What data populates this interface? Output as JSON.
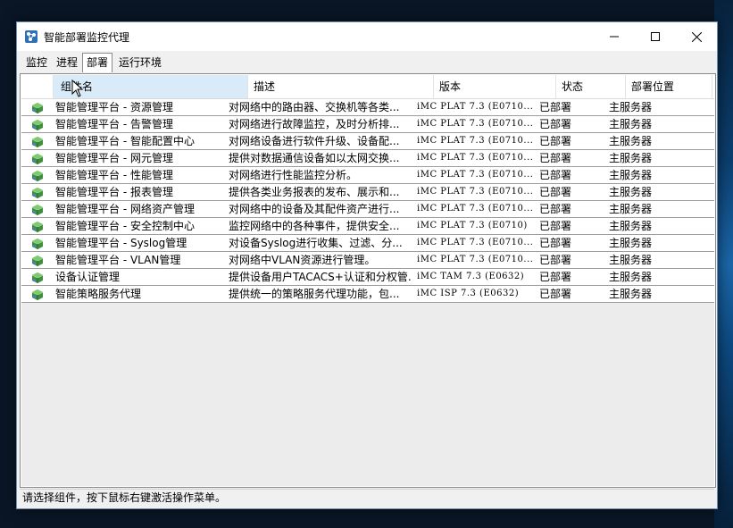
{
  "window": {
    "title": "智能部署监控代理",
    "buttons": {
      "minimize": "─",
      "maximize": "☐",
      "close": "✕"
    }
  },
  "tabs": [
    "监控",
    "进程",
    "部署",
    "运行环境"
  ],
  "active_tab": "部署",
  "table": {
    "columns": [
      "组件名",
      "描述",
      "版本",
      "状态",
      "部署位置"
    ],
    "rows": [
      [
        "智能管理平台 - 资源管理",
        "对网络中的路由器、交换机等各类...",
        "iMC PLAT 7.3 (E0710...",
        "已部署",
        "主服务器"
      ],
      [
        "智能管理平台 - 告警管理",
        "对网络进行故障监控，及时分析排...",
        "iMC PLAT 7.3 (E0710...",
        "已部署",
        "主服务器"
      ],
      [
        "智能管理平台 - 智能配置中心",
        "对网络设备进行软件升级、设备配...",
        "iMC PLAT 7.3 (E0710...",
        "已部署",
        "主服务器"
      ],
      [
        "智能管理平台 - 网元管理",
        "提供对数据通信设备如以太网交换...",
        "iMC PLAT 7.3 (E0710...",
        "已部署",
        "主服务器"
      ],
      [
        "智能管理平台 - 性能管理",
        "对网络进行性能监控分析。",
        "iMC PLAT 7.3 (E0710...",
        "已部署",
        "主服务器"
      ],
      [
        "智能管理平台 - 报表管理",
        "提供各类业务报表的发布、展示和...",
        "iMC PLAT 7.3 (E0710...",
        "已部署",
        "主服务器"
      ],
      [
        "智能管理平台 - 网络资产管理",
        "对网络中的设备及其配件资产进行...",
        "iMC PLAT 7.3 (E0710...",
        "已部署",
        "主服务器"
      ],
      [
        "智能管理平台 - 安全控制中心",
        "监控网络中的各种事件，提供安全...",
        "iMC PLAT 7.3 (E0710)",
        "已部署",
        "主服务器"
      ],
      [
        "智能管理平台 - Syslog管理",
        "对设备Syslog进行收集、过滤、分...",
        "iMC PLAT 7.3 (E0710...",
        "已部署",
        "主服务器"
      ],
      [
        "智能管理平台 - VLAN管理",
        "对网络中VLAN资源进行管理。",
        "iMC PLAT 7.3 (E0710...",
        "已部署",
        "主服务器"
      ],
      [
        "设备认证管理",
        "提供设备用户TACACS+认证和分权管...",
        "iMC TAM 7.3 (E0632)",
        "已部署",
        "主服务器"
      ],
      [
        "智能策略服务代理",
        "提供统一的策略服务代理功能，包...",
        "iMC ISP 7.3 (E0632)",
        "已部署",
        "主服务器"
      ]
    ]
  },
  "status_bar": "请选择组件，按下鼠标右键激活操作菜单。",
  "colors": {
    "header_sorted_bg": "#d9ebf9",
    "window_bg": "#f0f0f0",
    "row_border": "#9c9c9c"
  },
  "icons": {
    "app": "network-monitor-icon",
    "row": "deployed-component-icon"
  }
}
